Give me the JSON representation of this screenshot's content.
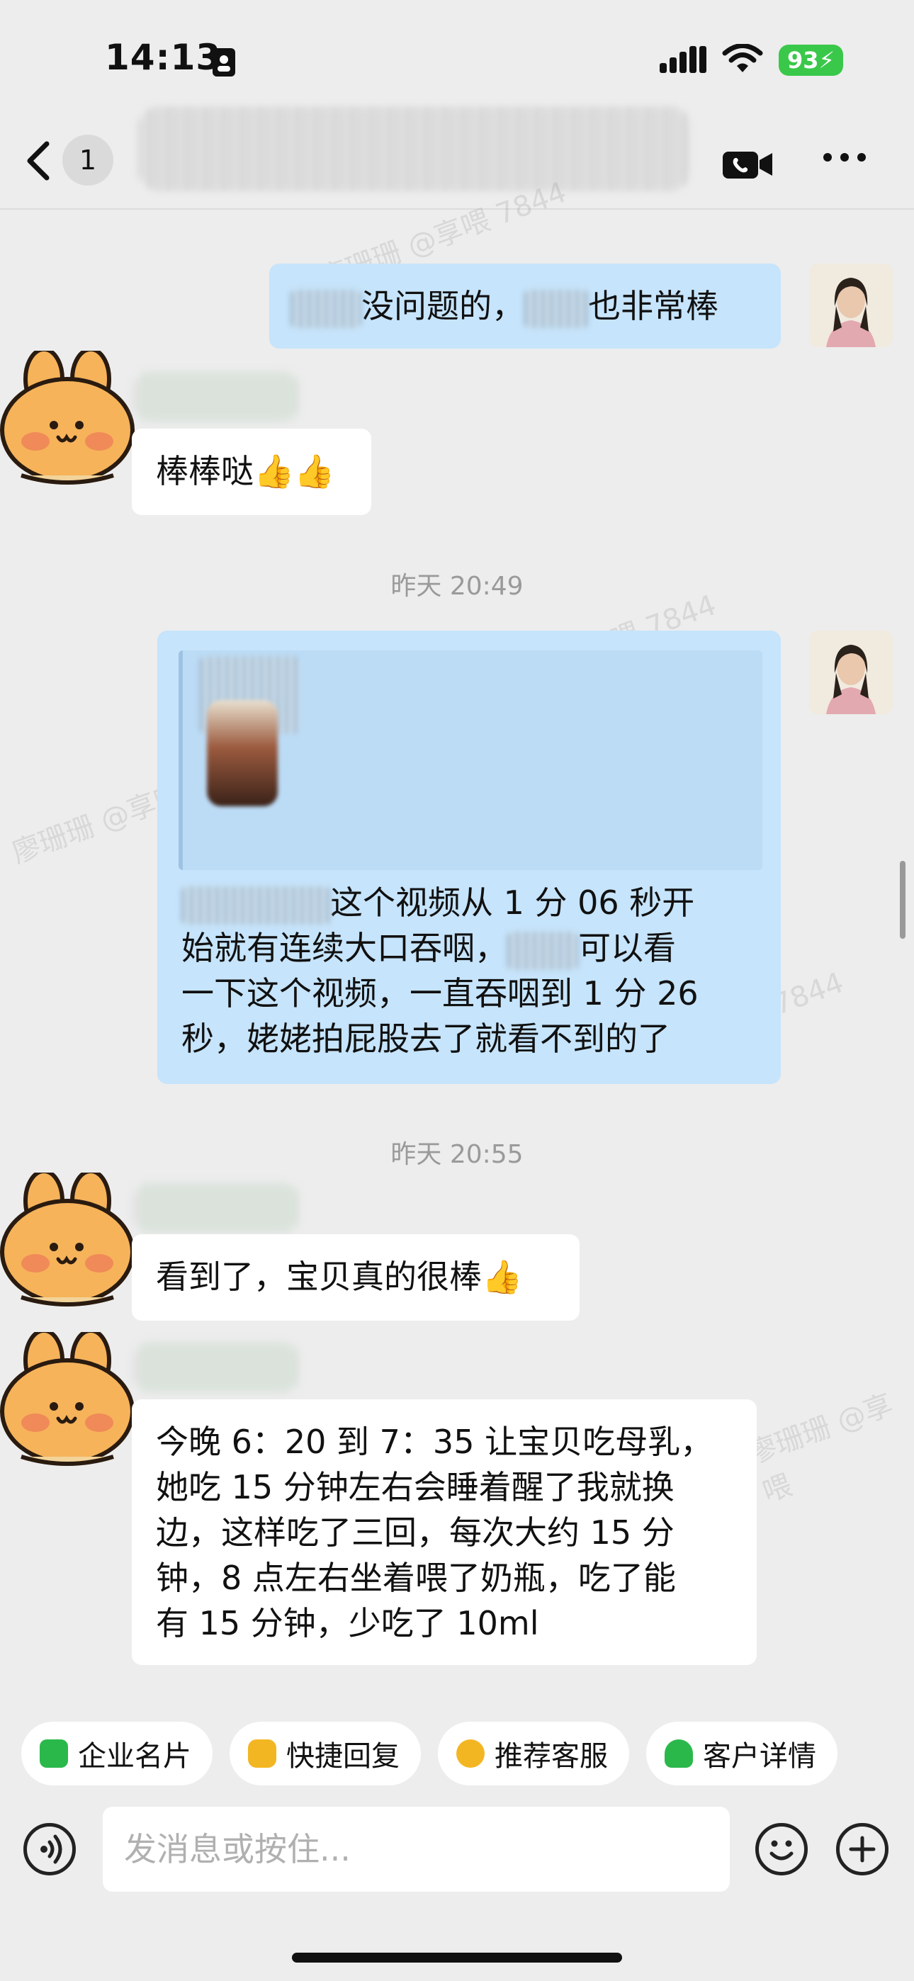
{
  "status_bar": {
    "time": "14:13",
    "battery": "93"
  },
  "header": {
    "unread_count": "1"
  },
  "messages": {
    "m1": {
      "text_a": "没问题的，",
      "text_b": "也非常棒"
    },
    "m2": {
      "text": "棒棒哒👍👍"
    },
    "ts1": "昨天 20:49",
    "m3": {
      "line1": "这个视频从 1 分 06 秒开",
      "line2a": "始就有连续大口吞咽，",
      "line2b": "可以看",
      "line3": "一下这个视频，一直吞咽到 1 分 26",
      "line4": "秒，姥姥拍屁股去了就看不到的了"
    },
    "ts2": "昨天 20:55",
    "m4": {
      "text": "看到了，宝贝真的很棒👍"
    },
    "m5": {
      "line1": "今晚 6：20 到 7：35 让宝贝吃母乳，",
      "line2": "她吃 15 分钟左右会睡着醒了我就换",
      "line3": "边，这样吃了三回，每次大约 15 分",
      "line4": "钟，8 点左右坐着喂了奶瓶，吃了能",
      "line5": "有 15 分钟，少吃了 10ml"
    }
  },
  "watermarks": [
    "廖珊珊 @享喂 7844",
    "@享喂 7844",
    "廖珊珊 @享喂",
    "7844",
    "廖珊珊 @享喂"
  ],
  "quick_actions": [
    {
      "label": "企业名片",
      "icon": "card-icon",
      "color": "#2bb84b"
    },
    {
      "label": "快捷回复",
      "icon": "quick-reply-icon",
      "color": "#f3b623"
    },
    {
      "label": "推荐客服",
      "icon": "service-icon",
      "color": "#f3b623"
    },
    {
      "label": "客户详情",
      "icon": "customer-icon",
      "color": "#2bb84b"
    }
  ],
  "input": {
    "placeholder": "发消息或按住..."
  },
  "colors": {
    "bubble_me": "#c6e4fb",
    "bubble_them": "#ffffff",
    "background": "#ededed"
  }
}
